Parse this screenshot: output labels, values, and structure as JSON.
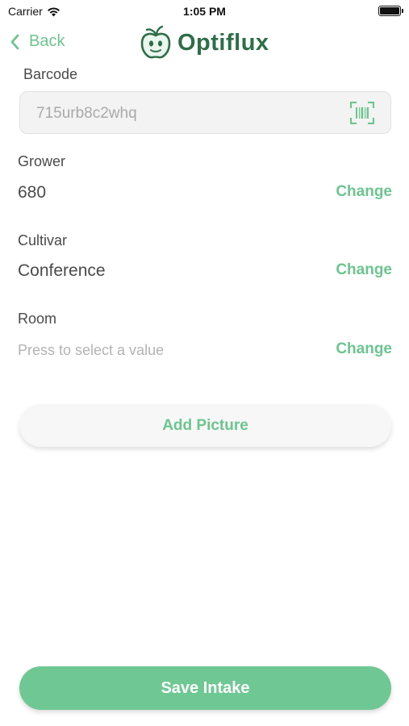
{
  "status_bar": {
    "carrier": "Carrier",
    "time": "1:05 PM",
    "wifi_icon": "wifi-icon",
    "battery_icon": "battery-icon",
    "battery_level": 1.0
  },
  "nav": {
    "back_label": "Back",
    "logo_text": "Optiflux",
    "back_icon": "chevron-left-icon",
    "logo_icon": "apple-logo-icon"
  },
  "form": {
    "barcode": {
      "label": "Barcode",
      "value": "715urb8c2whq",
      "icon": "barcode-scan-icon"
    },
    "grower": {
      "label": "Grower",
      "value": "680",
      "action": "Change"
    },
    "cultivar": {
      "label": "Cultivar",
      "value": "Conference",
      "action": "Change"
    },
    "room": {
      "label": "Room",
      "placeholder": "Press to select a value",
      "action": "Change"
    }
  },
  "buttons": {
    "add_picture": "Add Picture",
    "save_intake": "Save Intake"
  },
  "colors": {
    "accent": "#6cc58f",
    "brand_dark": "#2d6e48",
    "save_button": "#6fc893",
    "text": "#4a4a4a",
    "placeholder": "#b3b3b3"
  }
}
